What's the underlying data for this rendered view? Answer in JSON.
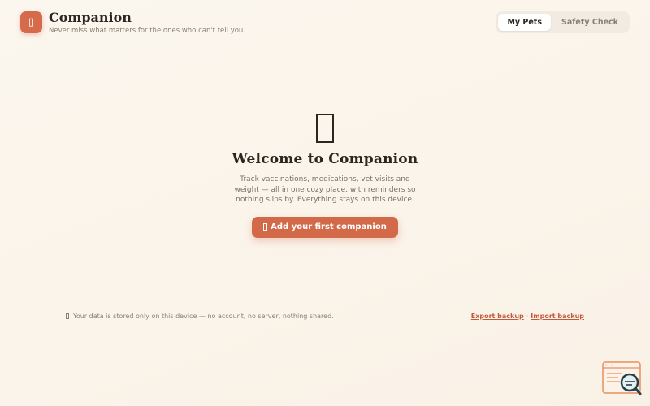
{
  "header": {
    "logo_glyph": "▯",
    "title": "Companion",
    "tagline": "Never miss what matters for the ones who can't tell you."
  },
  "nav": {
    "tabs": [
      {
        "label": "My Pets",
        "active": true
      },
      {
        "label": "Safety Check",
        "active": false
      }
    ]
  },
  "hero": {
    "icon": "placeholder-glyph-icon",
    "title": "Welcome to Companion",
    "description": "Track vaccinations, medications, vet visits and weight — all in one cozy place, with reminders so nothing slips by. Everything stays on this device.",
    "cta_label": "Add your first companion"
  },
  "footer": {
    "note": "Your data is stored only on this device — no account, no server, nothing shared.",
    "export_label": "Export backup",
    "separator": "·",
    "import_label": "Import backup"
  },
  "colors": {
    "accent": "#d26a4a",
    "link": "#c4593a",
    "background": "#fbf6ee",
    "text": "#2b2620"
  }
}
